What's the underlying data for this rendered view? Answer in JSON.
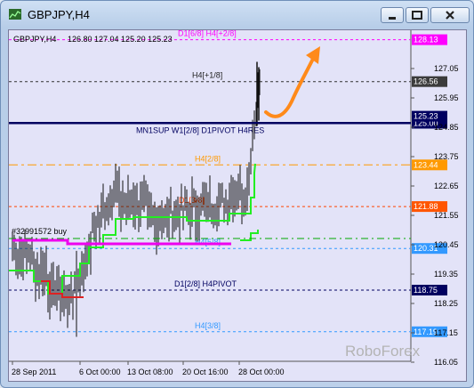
{
  "window": {
    "title": "GBPJPY,H4"
  },
  "chart_data": {
    "type": "candlestick",
    "header": {
      "symbol": "GBPJPY,H4",
      "ohlc": "126.80 127.04 125.20 125.23"
    },
    "y_ticks": [
      "127.05",
      "125.95",
      "124.85",
      "123.75",
      "122.65",
      "121.55",
      "120.45",
      "119.35",
      "118.25",
      "117.15",
      "116.05"
    ],
    "x_ticks": [
      "28 Sep 2011",
      "6 Oct 00:00",
      "13 Oct 08:00",
      "20 Oct 16:00",
      "28 Oct 00:00"
    ],
    "levels": [
      {
        "label": "D1[6/8] H4[+2/8]",
        "price": "128.13",
        "color": "#ff00ff",
        "style": "dotted",
        "price_bg": "#ff00ff"
      },
      {
        "label": "H4[+1/8]",
        "price": "126.56",
        "color": "#333333",
        "style": "dotted",
        "price_bg": "#3c3c3c"
      },
      {
        "label": "MN1SUP W1[2/8] D1PIVOT H4RES",
        "price": "125.00",
        "color": "#000060",
        "style": "solid",
        "price_bg": "#000060"
      },
      {
        "label": "H4[2/8]",
        "price": "123.44",
        "color": "#ff9900",
        "style": "dotted",
        "price_bg": "#ff9900"
      },
      {
        "label": "D1[3/8]",
        "price": "121.88",
        "color": "#ff4400",
        "style": "dotted",
        "price_bg": "#ff5500"
      },
      {
        "label": "H4[5/8]",
        "price": "120.31",
        "color": "#3399ff",
        "style": "dotted",
        "price_bg": "#3399ff"
      },
      {
        "label": "D1[2/8] H4PIVOT",
        "price": "118.75",
        "color": "#000060",
        "style": "dotted",
        "price_bg": "#000060"
      },
      {
        "label": "H4[3/8]",
        "price": "117.19",
        "color": "#3399ff",
        "style": "dotted",
        "price_bg": "#3399ff"
      }
    ],
    "current_price": "125.23",
    "order_label": "#32991572 buy",
    "watermark": "RoboForex"
  }
}
